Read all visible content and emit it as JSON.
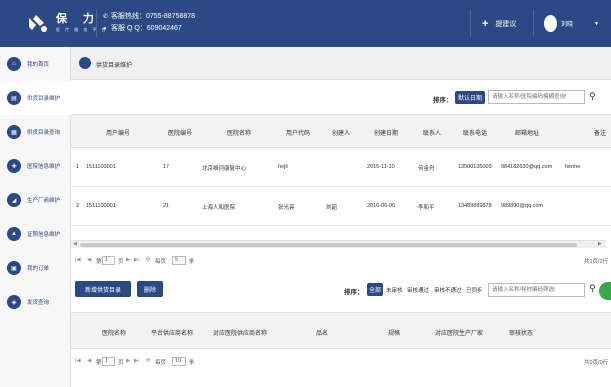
{
  "header": {
    "brand": "保 力",
    "brand_sub": "医 疗 服 务 平 台",
    "hotline": "客服热线：0755-88758878",
    "qq": "客服 Q Q：609042467",
    "suggest_label": "提建议",
    "user_name": "刘晓"
  },
  "sidebar": {
    "items": [
      {
        "label": "我的首页",
        "icon": "home-icon"
      },
      {
        "label": "供货目录维护",
        "icon": "catalog-icon"
      },
      {
        "label": "供货目录查询",
        "icon": "search-icon"
      },
      {
        "label": "医院信息维护",
        "icon": "hospital-icon"
      },
      {
        "label": "生产厂商维护",
        "icon": "factory-icon"
      },
      {
        "label": "证照信息维护",
        "icon": "license-icon"
      },
      {
        "label": "我的订单",
        "icon": "order-icon"
      },
      {
        "label": "发货查询",
        "icon": "shipping-icon"
      }
    ]
  },
  "tab": {
    "title": "供货目录维护"
  },
  "grid1": {
    "sort_label": "排序：",
    "sort_button": "默认日期",
    "search_placeholder": "请输入名称/医院编码模糊查询!",
    "columns": [
      "用户编号",
      "医院编号",
      "医院名称",
      "用户代码",
      "创建人",
      "创建日期",
      "联系人",
      "联系电话",
      "邮箱地址",
      "备注"
    ],
    "rows": [
      {
        "num": "1",
        "user_no": "1511100001",
        "hosp_no": "17",
        "hosp_name": "北京维河康复中心",
        "user_code": "hejli",
        "creator": "",
        "date": "2015-11-10",
        "contact": "何金舟",
        "phone": "13500135009",
        "email": "984182630@qq.com",
        "note": "henhe"
      },
      {
        "num": "2",
        "user_no": "1511100001",
        "hosp_no": "21",
        "hosp_name": "上海人和医院",
        "user_code": "张光亮",
        "creator": "刘韶",
        "date": "2016-06-06",
        "contact": "李和平",
        "phone": "13489889878",
        "email": "989890@qq.com",
        "note": ""
      }
    ],
    "pager": {
      "page_prefix": "页",
      "page": "1",
      "page_total": "页，共1页",
      "per_page_label": "每页",
      "per_page": "5",
      "per_page_unit": "条",
      "summary": "共1页/2行"
    }
  },
  "grid2": {
    "add_button": "新增供货目录",
    "delete_button": "删除",
    "sort_label": "排序：",
    "filter_all": "全部",
    "filters": [
      "未审核",
      "审核通过",
      "审核不通过",
      "已同步"
    ],
    "search_placeholder": "请输入名称/耗材编码筛选!",
    "columns": [
      "医院名称",
      "平台供应商名称",
      "对应医院供应商名称",
      "品名",
      "规格",
      "对应医院生产厂家",
      "审核状态"
    ],
    "pager": {
      "page": "1",
      "page_total": "页，共0页",
      "per_page_label": "每页",
      "per_page": "10",
      "per_page_unit": "条",
      "summary": "共0页/0行"
    }
  },
  "colors": {
    "brand": "#2b4a85",
    "accent_green": "#3aa847"
  }
}
